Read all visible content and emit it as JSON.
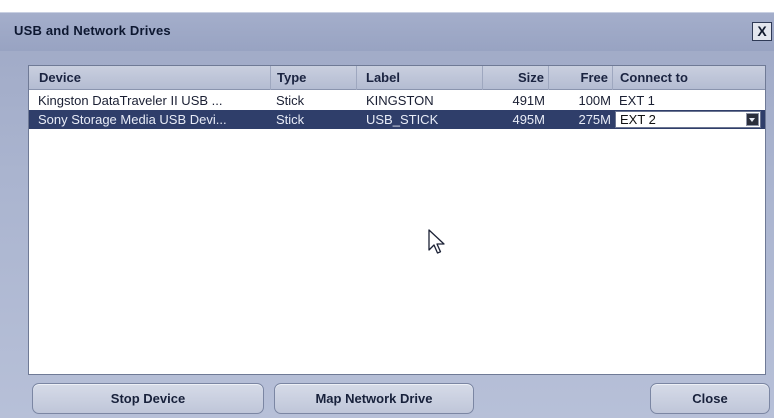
{
  "dialog": {
    "title": "USB and Network Drives",
    "close_glyph": "X"
  },
  "table": {
    "columns": [
      {
        "key": "device",
        "label": "Device"
      },
      {
        "key": "type",
        "label": "Type"
      },
      {
        "key": "label",
        "label": "Label"
      },
      {
        "key": "size",
        "label": "Size"
      },
      {
        "key": "free",
        "label": "Free"
      },
      {
        "key": "connect",
        "label": "Connect to"
      }
    ],
    "rows": [
      {
        "device": "Kingston DataTraveler II USB ...",
        "type": "Stick",
        "label": "KINGSTON",
        "size": "491M",
        "free": "100M",
        "connect": "EXT 1",
        "selected": false
      },
      {
        "device": "Sony Storage Media USB Devi...",
        "type": "Stick",
        "label": "USB_STICK",
        "size": "495M",
        "free": "275M",
        "connect": "EXT 2",
        "selected": true
      }
    ]
  },
  "buttons": {
    "stop_device": "Stop Device",
    "map_network_drive": "Map Network Drive",
    "close": "Close"
  },
  "icons": {
    "close": "close-icon",
    "dropdown": "chevron-down-icon",
    "cursor": "mouse-pointer-icon"
  },
  "colors": {
    "dialog_bg": "#aab4cf",
    "selected_row": "#2f3e6a",
    "button_bg": "#c9cfdf"
  }
}
